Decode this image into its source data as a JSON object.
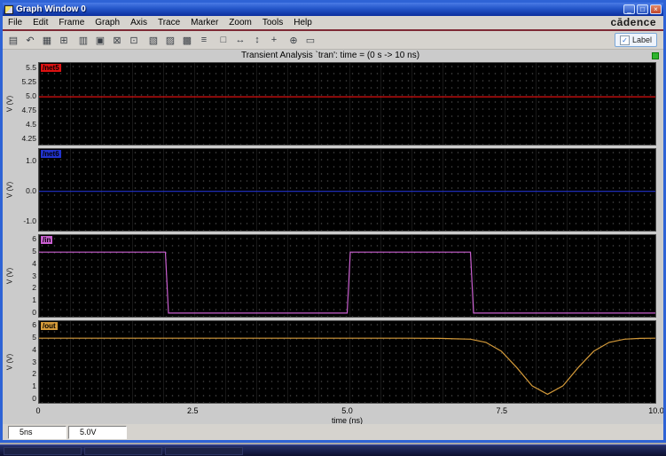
{
  "window": {
    "title": "Graph Window 0",
    "buttons": [
      {
        "name": "minimize-button",
        "glyph": "_"
      },
      {
        "name": "restore-button",
        "glyph": "□"
      },
      {
        "name": "close-button",
        "glyph": "×"
      }
    ]
  },
  "brand": {
    "logo": "cādence"
  },
  "menu": {
    "items": [
      "File",
      "Edit",
      "Frame",
      "Graph",
      "Axis",
      "Trace",
      "Marker",
      "Zoom",
      "Tools",
      "Help"
    ]
  },
  "toolbar": {
    "buttons": [
      {
        "name": "new-subwindow-button",
        "glyph": "▤"
      },
      {
        "name": "undo-button",
        "glyph": "↶"
      },
      {
        "name": "grid-on-button",
        "glyph": "▦"
      },
      {
        "name": "add-subwindow-button",
        "glyph": "⊞"
      },
      {
        "name": "vertical-strips-button",
        "glyph": "▥"
      },
      {
        "name": "overlay-mode-button",
        "glyph": "▣"
      },
      {
        "name": "copy-window-button",
        "glyph": "⊠"
      },
      {
        "name": "snapshot-button",
        "glyph": "⊡"
      },
      {
        "name": "strip-chart-button",
        "glyph": "▧"
      },
      {
        "name": "composite-mode-button",
        "glyph": "▨"
      },
      {
        "name": "smith-mode-button",
        "glyph": "▩"
      },
      {
        "name": "stack-traces-button",
        "glyph": "≡"
      },
      {
        "name": "zoom-fit-button",
        "glyph": "□"
      },
      {
        "name": "zoom-x-button",
        "glyph": "↔"
      },
      {
        "name": "zoom-y-button",
        "glyph": "↕"
      },
      {
        "name": "pan-button",
        "glyph": "+"
      },
      {
        "name": "marker-button",
        "glyph": "⊕"
      },
      {
        "name": "box-zoom-button",
        "glyph": "▭"
      }
    ],
    "label_checkbox": {
      "label": "Label",
      "checked": true,
      "checkmark": "✓"
    }
  },
  "graph": {
    "title": "Transient Analysis `tran': time = (0 s -> 10 ns)"
  },
  "xaxis": {
    "label": "time (ns)",
    "lim": [
      0,
      10
    ],
    "tick_values": [
      0,
      2.5,
      5,
      7.5,
      10
    ],
    "tick_labels": [
      "0",
      "2.5",
      "5.0",
      "7.5",
      "10.0"
    ]
  },
  "chart_data": [
    {
      "type": "line",
      "name": "/net5",
      "color": "#dd1111",
      "ylabel": "V (V)",
      "ylim": [
        4.15,
        5.6
      ],
      "ytick_values": [
        5.5,
        5.25,
        5.0,
        4.75,
        4.5,
        4.25
      ],
      "ytick_labels": [
        "5.5",
        "5.25",
        "5.0",
        "4.75",
        "4.5",
        "4.25"
      ],
      "x": [
        0,
        10
      ],
      "y": [
        5.0,
        5.0
      ]
    },
    {
      "type": "line",
      "name": "/net6",
      "color": "#2233cc",
      "ylabel": "V (V)",
      "ylim": [
        -1.3,
        1.4
      ],
      "ytick_values": [
        1.0,
        0.0,
        -1.0
      ],
      "ytick_labels": [
        "1.0",
        "0.0",
        "-1.0"
      ],
      "x": [
        0,
        10
      ],
      "y": [
        0.0,
        0.0
      ]
    },
    {
      "type": "line",
      "name": "/in",
      "color": "#c95fd0",
      "ylabel": "V (V)",
      "ylim": [
        -0.3,
        6.4
      ],
      "ytick_values": [
        6,
        5,
        4,
        3,
        2,
        1,
        0
      ],
      "ytick_labels": [
        "6",
        "5",
        "4",
        "3",
        "2",
        "1",
        "0"
      ],
      "x": [
        0,
        2.05,
        2.1,
        5.0,
        5.05,
        7.0,
        7.05,
        10
      ],
      "y": [
        5,
        5,
        0,
        0,
        5,
        5,
        0,
        0
      ]
    },
    {
      "type": "line",
      "name": "/out",
      "color": "#d49a3a",
      "ylabel": "V (V)",
      "ylim": [
        -0.3,
        6.4
      ],
      "ytick_values": [
        6,
        5,
        4,
        3,
        2,
        1,
        0
      ],
      "ytick_labels": [
        "6",
        "5",
        "4",
        "3",
        "2",
        "1",
        "0"
      ],
      "x": [
        0,
        6,
        6.5,
        7,
        7.25,
        7.5,
        7.75,
        8,
        8.25,
        8.5,
        8.75,
        9,
        9.25,
        9.5,
        9.75,
        10
      ],
      "y": [
        5,
        5,
        4.99,
        4.92,
        4.66,
        3.93,
        2.6,
        1.09,
        0.4,
        1.09,
        2.6,
        3.93,
        4.66,
        4.92,
        4.99,
        5
      ]
    }
  ],
  "statusbar": {
    "field1": "5ns",
    "field2": "5.0V"
  }
}
